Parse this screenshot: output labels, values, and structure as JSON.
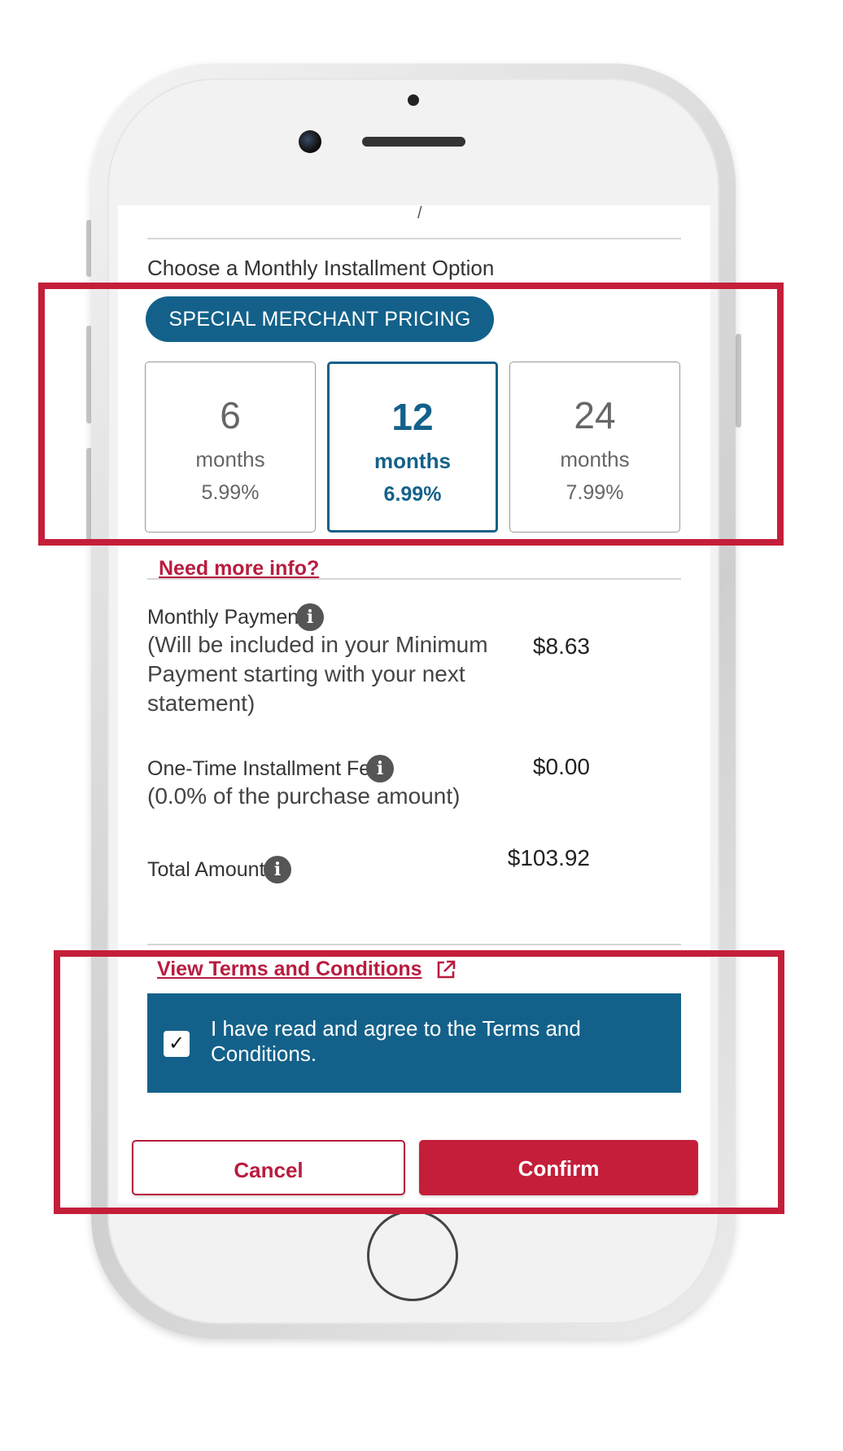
{
  "installment": {
    "cutoff_text": "/",
    "section_title": "Choose a Monthly Installment Option",
    "pricing_badge": "SPECIAL MERCHANT PRICING",
    "options": [
      {
        "number": "6",
        "unit": "months",
        "rate": "5.99%",
        "selected": false
      },
      {
        "number": "12",
        "unit": "months",
        "rate": "6.99%",
        "selected": true
      },
      {
        "number": "24",
        "unit": "months",
        "rate": "7.99%",
        "selected": false
      }
    ],
    "need_more_info": "Need more info?"
  },
  "summary": {
    "monthly_payment": {
      "label": "Monthly Payment",
      "sub": "(Will be included in your Minimum Payment starting with your next statement)",
      "amount": "$8.63"
    },
    "fee": {
      "label": "One-Time Installment Fee",
      "sub": "(0.0% of the purchase amount)",
      "amount": "$0.00"
    },
    "total": {
      "label": "Total Amount",
      "amount": "$103.92"
    }
  },
  "terms": {
    "link": "View Terms and Conditions",
    "agree_text": "I have read and agree to the Terms and Conditions.",
    "agreed": true,
    "checkmark": "✓"
  },
  "actions": {
    "cancel": "Cancel",
    "confirm": "Confirm"
  },
  "icons": {
    "info": "info-icon",
    "external_link": "external-link-icon",
    "info_glyph": "i"
  },
  "colors": {
    "brand_blue": "#13618a",
    "brand_red": "#c41e3a",
    "link_red": "#b81c3f"
  }
}
